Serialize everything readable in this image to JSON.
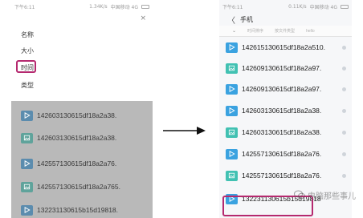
{
  "left_phone": {
    "status_bar": {
      "time": "下午6:11",
      "speed": "1.34K/s",
      "carrier": "中国移动 4G"
    },
    "sort_sheet": {
      "close_glyph": "×",
      "options": [
        "名称",
        "大小",
        "时间",
        "类型"
      ],
      "selected": "时间"
    },
    "files": [
      {
        "name": "142603130615df18a2a38.",
        "type": "video"
      },
      {
        "name": "142603130615df18a2a38.",
        "type": "image"
      },
      {
        "name": "142557130615df18a2a76.",
        "type": "video"
      },
      {
        "name": "142557130615df18a2a765.",
        "type": "image"
      },
      {
        "name": "132231130615b15d19818.",
        "type": "video"
      }
    ]
  },
  "right_phone": {
    "status_bar": {
      "time": "下午6:11",
      "speed": "0.11K/s",
      "carrier": "中国移动 4G"
    },
    "title": "手机",
    "back_glyph": "〈",
    "columns": [
      "时间排序",
      "按文件类型",
      "hello"
    ],
    "files": [
      {
        "name": "142615130615df18a2a510.",
        "type": "video"
      },
      {
        "name": "142609130615df18a2a97.",
        "type": "image"
      },
      {
        "name": "142609130615df18a2a97.",
        "type": "video"
      },
      {
        "name": "142603130615df18a2a38.",
        "type": "video"
      },
      {
        "name": "142603130615df18a2a38.",
        "type": "image"
      },
      {
        "name": "142557130615df18a2a76.",
        "type": "video"
      },
      {
        "name": "142557130615df18a2a76.",
        "type": "image"
      },
      {
        "name": "132231130615b15d19818",
        "type": "video"
      }
    ],
    "highlighted_file": "132231130615b15d19818"
  },
  "watermark": {
    "text": "电脑那些事儿"
  },
  "colors": {
    "highlight": "#b5296f",
    "video_icon": "#3aa2e0",
    "image_icon": "#41c1b2",
    "dim_overlay": "#b9b9b9"
  }
}
